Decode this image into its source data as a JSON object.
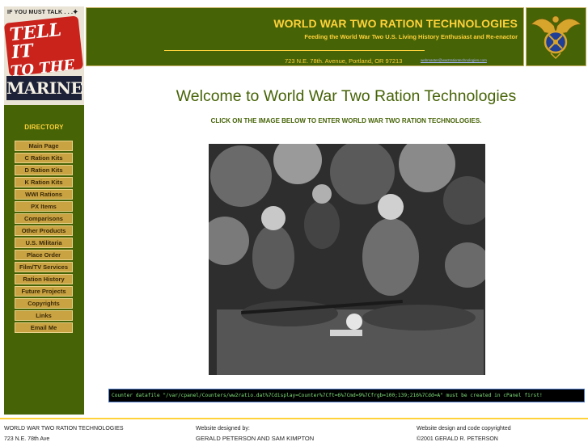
{
  "poster": {
    "top_text": "IF YOU MUST TALK . . .",
    "line1": "TELL IT",
    "line2": "TO THE",
    "bottom": "MARINES"
  },
  "header": {
    "title": "WORLD WAR TWO RATION TECHNOLOGIES",
    "tagline": "Feeding the World War Two U.S. Living History Enthusiast and Re-enactor",
    "address": "723 N.E. 78th. Avenue, Portland, OR   97213",
    "email": "webmaster@ww2rationtechnologies.com"
  },
  "nav": {
    "title": "DIRECTORY",
    "items": [
      {
        "label": "Main Page"
      },
      {
        "label": "C Ration Kits"
      },
      {
        "label": "D Ration Kits"
      },
      {
        "label": "K Ration Kits"
      },
      {
        "label": "WWI Rations"
      },
      {
        "label": "PX Items"
      },
      {
        "label": "Comparisons"
      },
      {
        "label": "Other Products"
      },
      {
        "label": "U.S. Militaria"
      },
      {
        "label": "Place Order"
      },
      {
        "label": "Film/TV Services"
      },
      {
        "label": "Ration History"
      },
      {
        "label": "Future Projects"
      },
      {
        "label": "Copyrights"
      },
      {
        "label": "Links"
      },
      {
        "label": "Email Me"
      }
    ]
  },
  "main": {
    "welcome": "Welcome to World War Two Ration Technologies",
    "instruction": "CLICK ON THE IMAGE BELOW TO ENTER WORLD WAR TWO RATION TECHNOLOGIES."
  },
  "counter": {
    "text": "Counter datafile \"/var/cpanel/Counters/ww2ratio.dat%7Cdisplay=Counter%7Cft=6%7Cmd=9%7Cfrgb=100;139;216%7Cdd=A\" must be created in cPanel first!"
  },
  "footer": {
    "col1_line1": "WORLD WAR TWO RATION TECHNOLOGIES",
    "col1_line2": "723 N.E. 78th Ave",
    "col2_line1": "Website designed by:",
    "col2_line2": "GERALD PETERSON AND SAM KIMPTON",
    "col3_line1": "Website design and code copyrighted",
    "col3_line2": "©2001 GERALD R. PETERSON"
  },
  "colors": {
    "olive": "#466306",
    "gold": "#ffd23a",
    "button": "#c9a241",
    "counter_text": "#7fe07a"
  }
}
